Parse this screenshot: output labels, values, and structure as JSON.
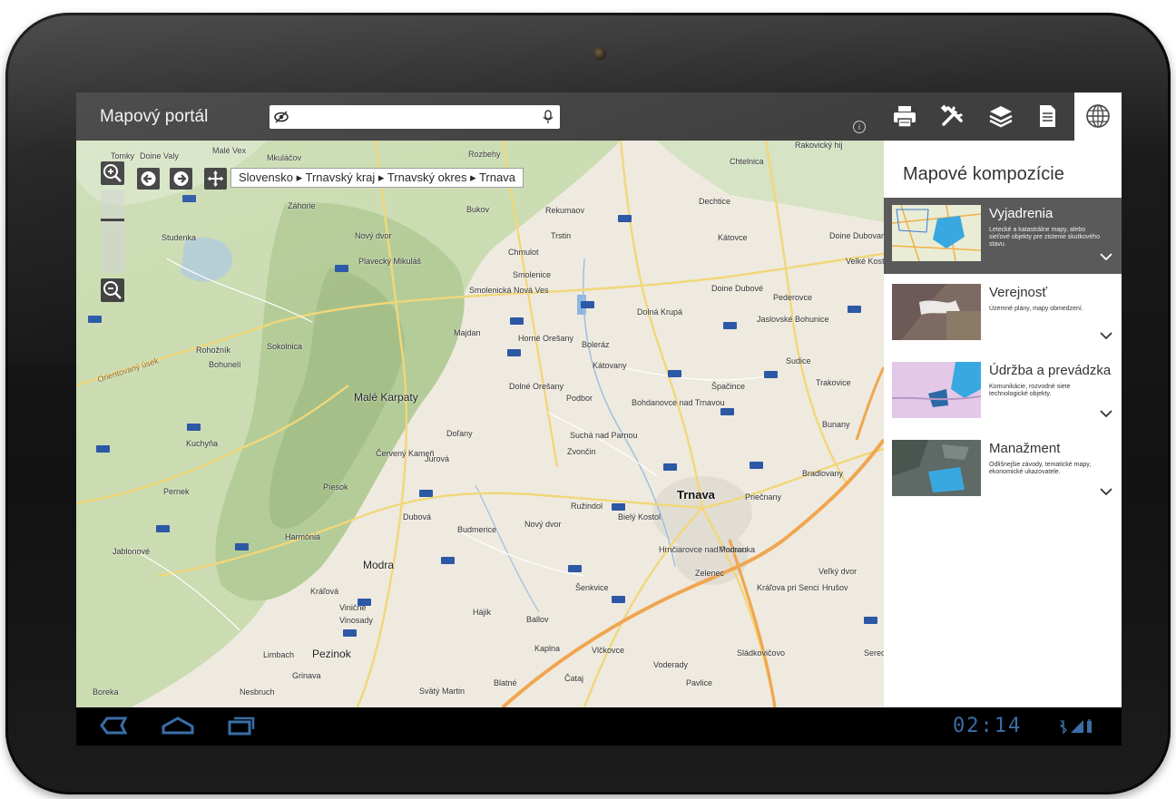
{
  "app": {
    "title": "Mapový portál"
  },
  "search": {
    "value": "",
    "placeholder": ""
  },
  "toolbar": {
    "tools": [
      "print-icon",
      "tools-icon",
      "layers-icon",
      "document-icon",
      "globe-icon"
    ],
    "active": "globe-icon"
  },
  "map": {
    "breadcrumb": "Slovensko ▸ Trnavský kraj ▸ Trnavský okres ▸ Trnava",
    "places": [
      "Tomky",
      "Doine Valy",
      "Malé Vex",
      "Mkuláčov",
      "Rozbehy",
      "Chtelnica",
      "Rakovický hij",
      "Záhorie",
      "Bukov",
      "Rekumaov",
      "Dechtice",
      "Studenka",
      "Nový dvor",
      "Trstin",
      "Kátovce",
      "Doine Dubovany",
      "Plavecký Mikuláš",
      "Chmulot",
      "Velké Kostoľany",
      "Smolenice",
      "Smolenická Nová Ves",
      "Doine Dubové",
      "Dolná Krupá",
      "Pederovce",
      "Majdan",
      "Horné Orešany",
      "Jaslovské Bohunice",
      "Rohožník",
      "Sokolnica",
      "Boleráz",
      "Bohunelí",
      "Kátovany",
      "Sudice",
      "Dolné Orešany",
      "Podbor",
      "Špačince",
      "Malé Karpaty",
      "Bohdanovce nad Trnavou",
      "Trakovice",
      "Kuchyňa",
      "Doľany",
      "Suchá nad Parnou",
      "Bunany",
      "Červený Kameň",
      "Zvončin",
      "Pernek",
      "Píesok",
      "Jurová",
      "Bradlovany",
      "Modra",
      "Dubová",
      "Budmerice",
      "Nový dvor",
      "Ružindol",
      "Bielý Kostol",
      "Trnava",
      "Priečnany",
      "Jablonové",
      "Harmónia",
      "Hrnčiarovce nad Parnou",
      "Modranka",
      "Kráľová",
      "Viničné",
      "Šenkvice",
      "Ballov",
      "Kráľova pri Senci",
      "Pezinok",
      "Limbach",
      "Grinava",
      "Vinosady",
      "Hájik",
      "Kaplna",
      "Vlčkovce",
      "Voderady",
      "Sládkovičovo",
      "Boreka",
      "Nesbruch",
      "Svätý Martin",
      "Blatné",
      "Čataj",
      "Pavlice",
      "Zelenec",
      "Veľký dvor",
      "Hrušov",
      "Sereď"
    ],
    "road_label": "Orientovaný úsek"
  },
  "panel": {
    "title": "Mapové kompozície",
    "compositions": [
      {
        "title": "Vyjadrenia",
        "desc": "Letecké a katastrálne mapy, alebo sieťové objekty pre zistenie skutkového stavu.",
        "active": true
      },
      {
        "title": "Verejnosť",
        "desc": "Územné plány, mapy obmedzení.",
        "active": false
      },
      {
        "title": "Údržba a prevádzka",
        "desc": "Komunikácie, rozvodné siete technologické objekty.",
        "active": false
      },
      {
        "title": "Manažment",
        "desc": "Odlišnejšie závody, tematické mapy, ekonomické ukazovatele.",
        "active": false
      }
    ]
  },
  "statusbar": {
    "time": "02:14"
  },
  "colors": {
    "bar": "#3f3f3f",
    "accent": "#1aa2d8",
    "nav_icon": "#3a6ea8",
    "panel_active": "#5a5a5a"
  }
}
